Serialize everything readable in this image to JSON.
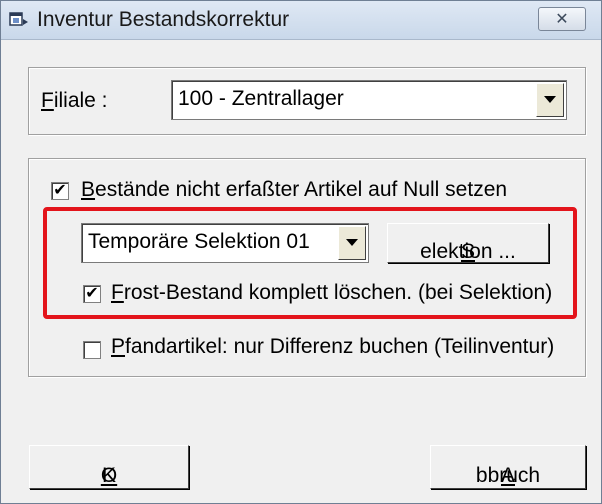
{
  "window": {
    "title": "Inventur Bestandskorrektur",
    "close_symbol": "✕",
    "accent_color": "#e3141b"
  },
  "filiale": {
    "label_accel": "F",
    "label_rest": "iliale :",
    "value": "100 - Zentrallager"
  },
  "options": {
    "reset_checked": true,
    "reset_accel": "B",
    "reset_rest": "estände nicht erfaßter Artikel auf Null setzen",
    "selection_value": "Temporäre Selektion 01",
    "selection_button_accel": "S",
    "selection_button_rest": "elektion ...",
    "frost_checked": true,
    "frost_accel": "F",
    "frost_rest": "rost-Bestand komplett löschen. (bei Selektion)",
    "pfand_checked": false,
    "pfand_accel": "P",
    "pfand_rest": "fandartikel: nur Differenz buchen (Teilinventur)",
    "check_symbol": "✔"
  },
  "buttons": {
    "ok_accel": "O",
    "ok_rest": "K",
    "cancel_accel": "A",
    "cancel_rest": "bbruch"
  },
  "icons": {
    "app": "window-app-icon",
    "close": "close-icon",
    "dropdown": "chevron-down-icon"
  }
}
